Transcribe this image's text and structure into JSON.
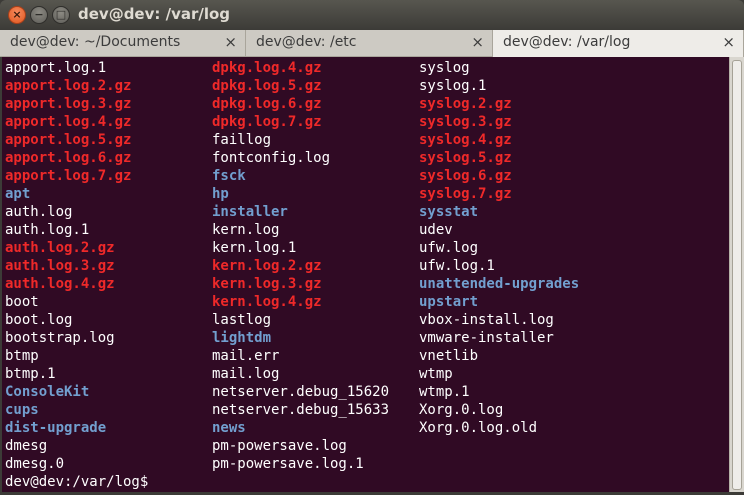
{
  "window": {
    "title": "dev@dev: /var/log",
    "close_glyph": "×",
    "min_glyph": "−",
    "max_glyph": "□"
  },
  "tabs": [
    {
      "label": "dev@dev: ~/Documents",
      "close": "×"
    },
    {
      "label": "dev@dev: /etc",
      "close": "×"
    },
    {
      "label": "dev@dev: /var/log",
      "close": "×"
    }
  ],
  "colors": {
    "plain": "#ffffff",
    "archive": "#ef2929",
    "directory": "#729fcf",
    "background": "#300a24"
  },
  "listing": {
    "col1": [
      {
        "t": "apport.log.1",
        "k": "plain"
      },
      {
        "t": "apport.log.2.gz",
        "k": "gz"
      },
      {
        "t": "apport.log.3.gz",
        "k": "gz"
      },
      {
        "t": "apport.log.4.gz",
        "k": "gz"
      },
      {
        "t": "apport.log.5.gz",
        "k": "gz"
      },
      {
        "t": "apport.log.6.gz",
        "k": "gz"
      },
      {
        "t": "apport.log.7.gz",
        "k": "gz"
      },
      {
        "t": "apt",
        "k": "dir"
      },
      {
        "t": "auth.log",
        "k": "plain"
      },
      {
        "t": "auth.log.1",
        "k": "plain"
      },
      {
        "t": "auth.log.2.gz",
        "k": "gz"
      },
      {
        "t": "auth.log.3.gz",
        "k": "gz"
      },
      {
        "t": "auth.log.4.gz",
        "k": "gz"
      },
      {
        "t": "boot",
        "k": "plain"
      },
      {
        "t": "boot.log",
        "k": "plain"
      },
      {
        "t": "bootstrap.log",
        "k": "plain"
      },
      {
        "t": "btmp",
        "k": "plain"
      },
      {
        "t": "btmp.1",
        "k": "plain"
      },
      {
        "t": "ConsoleKit",
        "k": "dir"
      },
      {
        "t": "cups",
        "k": "dir"
      },
      {
        "t": "dist-upgrade",
        "k": "dir"
      },
      {
        "t": "dmesg",
        "k": "plain"
      },
      {
        "t": "dmesg.0",
        "k": "plain"
      }
    ],
    "col2": [
      {
        "t": "dpkg.log.4.gz",
        "k": "gz"
      },
      {
        "t": "dpkg.log.5.gz",
        "k": "gz"
      },
      {
        "t": "dpkg.log.6.gz",
        "k": "gz"
      },
      {
        "t": "dpkg.log.7.gz",
        "k": "gz"
      },
      {
        "t": "faillog",
        "k": "plain"
      },
      {
        "t": "fontconfig.log",
        "k": "plain"
      },
      {
        "t": "fsck",
        "k": "dir"
      },
      {
        "t": "hp",
        "k": "dir"
      },
      {
        "t": "installer",
        "k": "dir"
      },
      {
        "t": "kern.log",
        "k": "plain"
      },
      {
        "t": "kern.log.1",
        "k": "plain"
      },
      {
        "t": "kern.log.2.gz",
        "k": "gz"
      },
      {
        "t": "kern.log.3.gz",
        "k": "gz"
      },
      {
        "t": "kern.log.4.gz",
        "k": "gz"
      },
      {
        "t": "lastlog",
        "k": "plain"
      },
      {
        "t": "lightdm",
        "k": "dir"
      },
      {
        "t": "mail.err",
        "k": "plain"
      },
      {
        "t": "mail.log",
        "k": "plain"
      },
      {
        "t": "netserver.debug_15620",
        "k": "plain"
      },
      {
        "t": "netserver.debug_15633",
        "k": "plain"
      },
      {
        "t": "news",
        "k": "dir"
      },
      {
        "t": "pm-powersave.log",
        "k": "plain"
      },
      {
        "t": "pm-powersave.log.1",
        "k": "plain"
      }
    ],
    "col3": [
      {
        "t": "syslog",
        "k": "plain"
      },
      {
        "t": "syslog.1",
        "k": "plain"
      },
      {
        "t": "syslog.2.gz",
        "k": "gz"
      },
      {
        "t": "syslog.3.gz",
        "k": "gz"
      },
      {
        "t": "syslog.4.gz",
        "k": "gz"
      },
      {
        "t": "syslog.5.gz",
        "k": "gz"
      },
      {
        "t": "syslog.6.gz",
        "k": "gz"
      },
      {
        "t": "syslog.7.gz",
        "k": "gz"
      },
      {
        "t": "sysstat",
        "k": "dir"
      },
      {
        "t": "udev",
        "k": "plain"
      },
      {
        "t": "ufw.log",
        "k": "plain"
      },
      {
        "t": "ufw.log.1",
        "k": "plain"
      },
      {
        "t": "unattended-upgrades",
        "k": "dir"
      },
      {
        "t": "upstart",
        "k": "dir"
      },
      {
        "t": "vbox-install.log",
        "k": "plain"
      },
      {
        "t": "vmware-installer",
        "k": "plain"
      },
      {
        "t": "vnetlib",
        "k": "plain"
      },
      {
        "t": "wtmp",
        "k": "plain"
      },
      {
        "t": "wtmp.1",
        "k": "plain"
      },
      {
        "t": "Xorg.0.log",
        "k": "plain"
      },
      {
        "t": "Xorg.0.log.old",
        "k": "plain"
      }
    ]
  },
  "prompt": "dev@dev:/var/log$"
}
